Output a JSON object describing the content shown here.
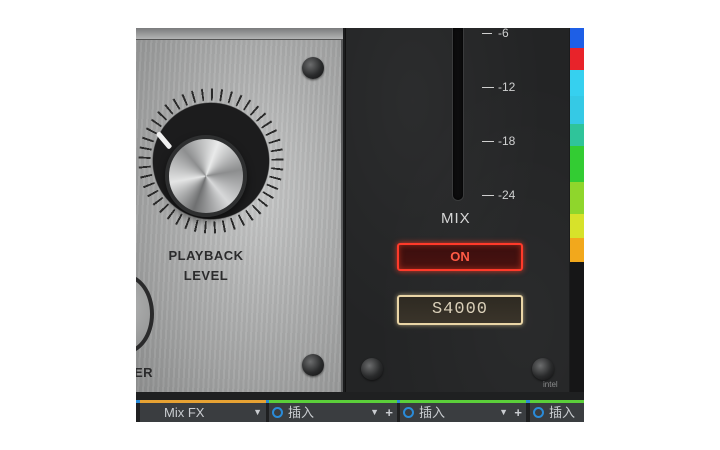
{
  "plugin": {
    "playback_level_label_line1": "PLAYBACK",
    "playback_level_label_line2": "LEVEL",
    "partial_label": "ER",
    "mix_label": "MIX",
    "scale": [
      "-6",
      "-12",
      "-18",
      "-24"
    ],
    "on_button": "ON",
    "model_button": "S4000",
    "badge": "intel"
  },
  "mixer": {
    "slots": [
      {
        "label": "Mix FX",
        "arrow": "▼",
        "plus": ""
      },
      {
        "label": "插入",
        "arrow": "▼",
        "plus": "+"
      },
      {
        "label": "插入",
        "arrow": "▼",
        "plus": "+"
      },
      {
        "label": "插入",
        "arrow": "",
        "plus": ""
      }
    ],
    "colors": {
      "mixfx": "#e7a233",
      "insert": "#5bcf3a",
      "accent": "#2a8bd8"
    }
  }
}
